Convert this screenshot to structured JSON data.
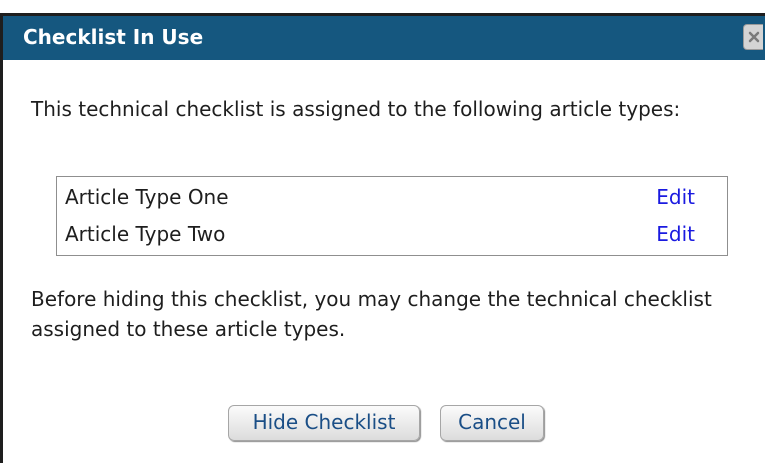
{
  "dialog": {
    "title": "Checklist In Use",
    "intro": "This technical checklist is assigned to the following article types:",
    "article_types": [
      {
        "name": "Article Type One",
        "action": "Edit"
      },
      {
        "name": "Article Type Two",
        "action": "Edit"
      }
    ],
    "note": "Before hiding this checklist, you may change the technical checklist assigned to these article types.",
    "buttons": {
      "hide": "Hide Checklist",
      "cancel": "Cancel"
    },
    "icons": {
      "close": "close-icon"
    },
    "colors": {
      "titlebar": "#15577f",
      "link": "#1a1ae0",
      "button_text": "#1a4e86"
    }
  }
}
